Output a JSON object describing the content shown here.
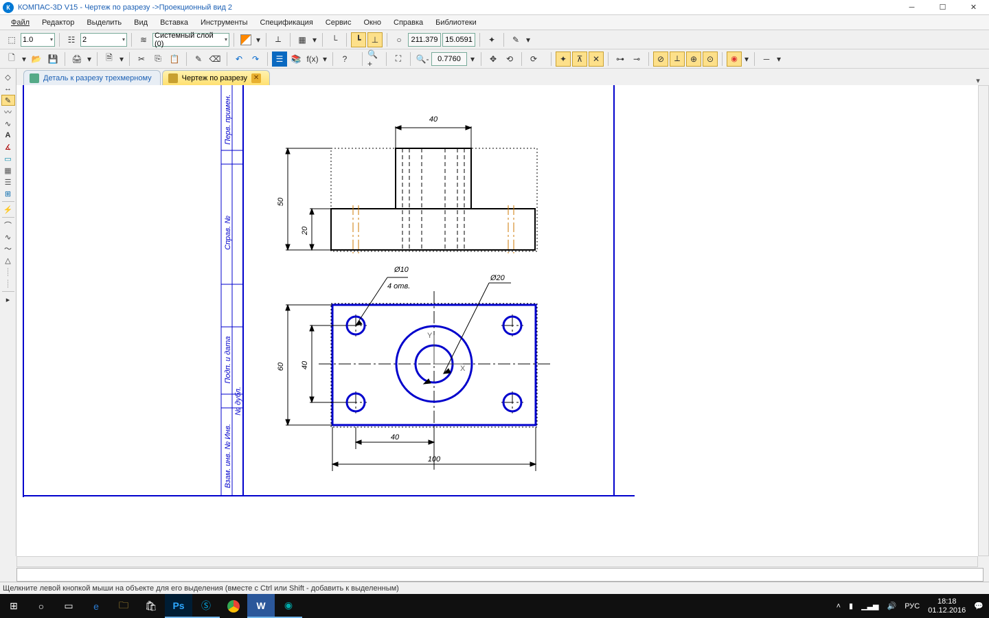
{
  "titlebar": {
    "title": "КОМПАС-3D V15 - Чертеж по разрезу ->Проекционный вид 2"
  },
  "menu": [
    "Файл",
    "Редактор",
    "Выделить",
    "Вид",
    "Вставка",
    "Инструменты",
    "Спецификация",
    "Сервис",
    "Окно",
    "Справка",
    "Библиотеки"
  ],
  "toolbar1": {
    "scale": "1.0",
    "view": "2",
    "layer": "Системный слой (0)",
    "coordX": "211.379",
    "coordY": "15.0591"
  },
  "toolbar2": {
    "zoom": "0.7760"
  },
  "tabs": [
    {
      "label": "Деталь к разрезу трехмерному"
    },
    {
      "label": "Чертеж по разрезу"
    }
  ],
  "titleblock": [
    "Перв. примен.",
    "Справ. №",
    "Подп. и дата",
    "№ дубл.",
    "Взам. инв. № Инв."
  ],
  "dims": {
    "d40a": "40",
    "d50": "50",
    "d20": "20",
    "phi10": "Ø10",
    "otv4": "4 отв.",
    "phi20": "Ø20",
    "d60": "60",
    "d40b": "40",
    "d40c": "40",
    "d100": "100"
  },
  "labels": {
    "x": "X",
    "y": "Y"
  },
  "statusbar": {
    "text": "Щелкните левой кнопкой мыши на объекте для его выделения (вместе с Ctrl или Shift - добавить к выделенным)"
  },
  "taskbar": {
    "lang": "РУС",
    "time": "18:18",
    "date": "01.12.2016"
  }
}
